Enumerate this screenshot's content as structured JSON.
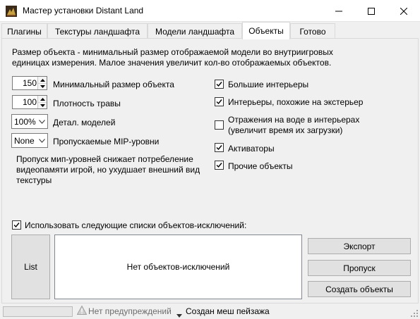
{
  "window": {
    "title": "Мастер установки Distant Land"
  },
  "tabs": [
    {
      "label": "Плагины"
    },
    {
      "label": "Текстуры ландшафта"
    },
    {
      "label": "Модели ландшафта"
    },
    {
      "label": "Объекты",
      "active": true
    },
    {
      "label": "Готово"
    }
  ],
  "description": {
    "line1": "Размер объекта - минимальный размер отображаемой модели во внутриигровых",
    "line2": "единицах измерения. Малое значения увеличит кол-во отображаемых объектов."
  },
  "settings": {
    "min_size": {
      "value": "150",
      "label": "Минимальный размер объекта"
    },
    "grass_density": {
      "value": "100",
      "label": "Плотность травы"
    },
    "detail": {
      "value": "100%",
      "label": "Детал. моделей"
    },
    "mip": {
      "value": "None",
      "label": "Пропускаемые MIP-уровни"
    }
  },
  "mip_note": {
    "line1": "Пропуск мип-уровней снижает потребеление",
    "line2": "видеопамяти игрой, но ухудшает внешний вид",
    "line3": "текстуры"
  },
  "checkboxes": [
    {
      "label": "Большие интерьеры",
      "checked": true
    },
    {
      "label": "Интерьеры, похожие на экстерьер",
      "checked": true
    },
    {
      "label": "Отражения на воде в интерьерах",
      "label2": "(увеличит время их загрузки)",
      "checked": false
    },
    {
      "label": "Активаторы",
      "checked": true
    },
    {
      "label": "Прочие объекты",
      "checked": true
    }
  ],
  "exclusions": {
    "use_label": "Использовать следующие списки объектов-исключений:",
    "use_checked": true,
    "list_button": "List",
    "empty_text": "Нет объектов-исключений",
    "export_button": "Экспорт",
    "skip_button": "Пропуск",
    "create_button": "Создать объекты"
  },
  "status": {
    "progress": 0,
    "warnings": "Нет предупреждений",
    "message": "Создан меш пейзажа"
  },
  "icons": {
    "app": "app-icon",
    "warning": "warning-icon",
    "checkmark": "checkmark-icon"
  },
  "colors": {
    "tab_border": "#d9d9d9",
    "button_bg": "#e1e1e1"
  }
}
